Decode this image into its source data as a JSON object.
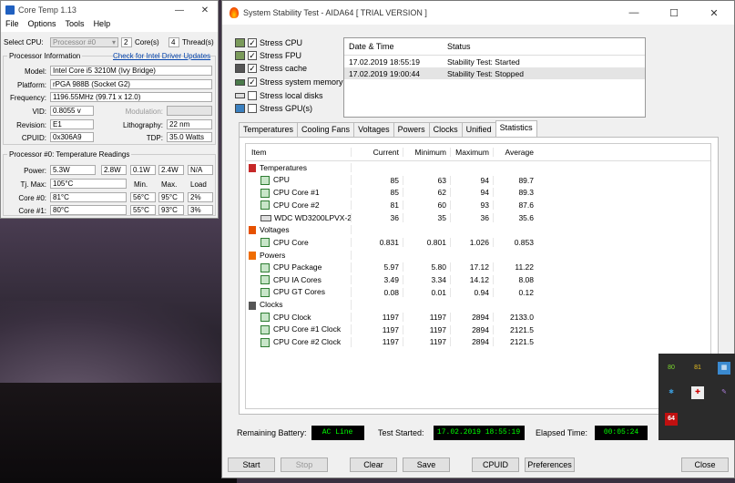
{
  "coretemp": {
    "title": "Core Temp 1.13",
    "menu": [
      "File",
      "Options",
      "Tools",
      "Help"
    ],
    "select_cpu_label": "Select CPU:",
    "select_cpu_value": "Processor #0",
    "cores_count": "2",
    "cores_label": "Core(s)",
    "threads_count": "4",
    "threads_label": "Thread(s)",
    "proc_info_label": "Processor Information",
    "driver_link": "Check for Intel Driver Updates",
    "model_label": "Model:",
    "model_value": "Intel Core i5 3210M (Ivy Bridge)",
    "platform_label": "Platform:",
    "platform_value": "rPGA 988B (Socket G2)",
    "frequency_label": "Frequency:",
    "frequency_value": "1196.55MHz (99.71 x 12.0)",
    "vid_label": "VID:",
    "vid_value": "0.8055 v",
    "modulation_label": "Modulation:",
    "revision_label": "Revision:",
    "revision_value": "E1",
    "lithography_label": "Lithography:",
    "lithography_value": "22 nm",
    "cpuid_label": "CPUID:",
    "cpuid_value": "0x306A9",
    "tdp_label": "TDP:",
    "tdp_value": "35.0 Watts",
    "temp_readings_label": "Processor #0: Temperature Readings",
    "power_label": "Power:",
    "power_values": [
      "5.3W",
      "2.8W",
      "0.1W",
      "2.4W",
      "N/A"
    ],
    "tjmax_label": "Tj. Max:",
    "tjmax_value": "105°C",
    "col_min": "Min.",
    "col_max": "Max.",
    "col_load": "Load",
    "cores": [
      {
        "label": "Core #0:",
        "temp": "81°C",
        "min": "56°C",
        "max": "95°C",
        "load": "2%"
      },
      {
        "label": "Core #1:",
        "temp": "80°C",
        "min": "55°C",
        "max": "93°C",
        "load": "3%"
      }
    ]
  },
  "aida": {
    "title": "System Stability Test - AIDA64  [ TRIAL VERSION ]",
    "stress": [
      {
        "label": "Stress CPU",
        "checked": true
      },
      {
        "label": "Stress FPU",
        "checked": true
      },
      {
        "label": "Stress cache",
        "checked": true
      },
      {
        "label": "Stress system memory",
        "checked": true
      },
      {
        "label": "Stress local disks",
        "checked": false
      },
      {
        "label": "Stress GPU(s)",
        "checked": false
      }
    ],
    "log_headers": {
      "date": "Date & Time",
      "status": "Status"
    },
    "log_rows": [
      {
        "date": "17.02.2019 18:55:19",
        "status": "Stability Test: Started"
      },
      {
        "date": "17.02.2019 19:00:44",
        "status": "Stability Test: Stopped"
      }
    ],
    "tabs": [
      "Temperatures",
      "Cooling Fans",
      "Voltages",
      "Powers",
      "Clocks",
      "Unified",
      "Statistics"
    ],
    "active_tab": "Statistics",
    "table_headers": {
      "item": "Item",
      "current": "Current",
      "minimum": "Minimum",
      "maximum": "Maximum",
      "average": "Average"
    },
    "table_rows": [
      {
        "type": "cat",
        "name": "Temperatures",
        "icon": "thermometer-icon"
      },
      {
        "type": "item",
        "name": "CPU",
        "cur": "85",
        "min": "63",
        "max": "94",
        "avg": "89.7"
      },
      {
        "type": "item",
        "name": "CPU Core #1",
        "cur": "85",
        "min": "62",
        "max": "94",
        "avg": "89.3"
      },
      {
        "type": "item",
        "name": "CPU Core #2",
        "cur": "81",
        "min": "60",
        "max": "93",
        "avg": "87.6"
      },
      {
        "type": "disk",
        "name": "WDC WD3200LPVX-2...",
        "cur": "36",
        "min": "35",
        "max": "36",
        "avg": "35.6"
      },
      {
        "type": "cat",
        "name": "Voltages",
        "icon": "voltage-icon"
      },
      {
        "type": "item",
        "name": "CPU Core",
        "cur": "0.831",
        "min": "0.801",
        "max": "1.026",
        "avg": "0.853"
      },
      {
        "type": "cat",
        "name": "Powers",
        "icon": "power-icon"
      },
      {
        "type": "item",
        "name": "CPU Package",
        "cur": "5.97",
        "min": "5.80",
        "max": "17.12",
        "avg": "11.22"
      },
      {
        "type": "item",
        "name": "CPU IA Cores",
        "cur": "3.49",
        "min": "3.34",
        "max": "14.12",
        "avg": "8.08"
      },
      {
        "type": "item",
        "name": "CPU GT Cores",
        "cur": "0.08",
        "min": "0.01",
        "max": "0.94",
        "avg": "0.12"
      },
      {
        "type": "cat",
        "name": "Clocks",
        "icon": "clock-icon"
      },
      {
        "type": "item",
        "name": "CPU Clock",
        "cur": "1197",
        "min": "1197",
        "max": "2894",
        "avg": "2133.0"
      },
      {
        "type": "item",
        "name": "CPU Core #1 Clock",
        "cur": "1197",
        "min": "1197",
        "max": "2894",
        "avg": "2121.5"
      },
      {
        "type": "item",
        "name": "CPU Core #2 Clock",
        "cur": "1197",
        "min": "1197",
        "max": "2894",
        "avg": "2121.5"
      }
    ],
    "remaining_battery_label": "Remaining Battery:",
    "remaining_battery_value": "AC Line",
    "test_started_label": "Test Started:",
    "test_started_value": "17.02.2019 18:55:19",
    "elapsed_label": "Elapsed Time:",
    "elapsed_value": "00:05:24",
    "buttons": {
      "start": "Start",
      "stop": "Stop",
      "clear": "Clear",
      "save": "Save",
      "cpuid": "CPUID",
      "preferences": "Preferences",
      "close": "Close"
    }
  },
  "tray": {
    "temp1": "80",
    "temp2": "81",
    "aida_badge": "64"
  },
  "colors": {
    "lcd_bg": "#000000",
    "lcd_text": "#00ff00",
    "link": "#0645ad"
  }
}
